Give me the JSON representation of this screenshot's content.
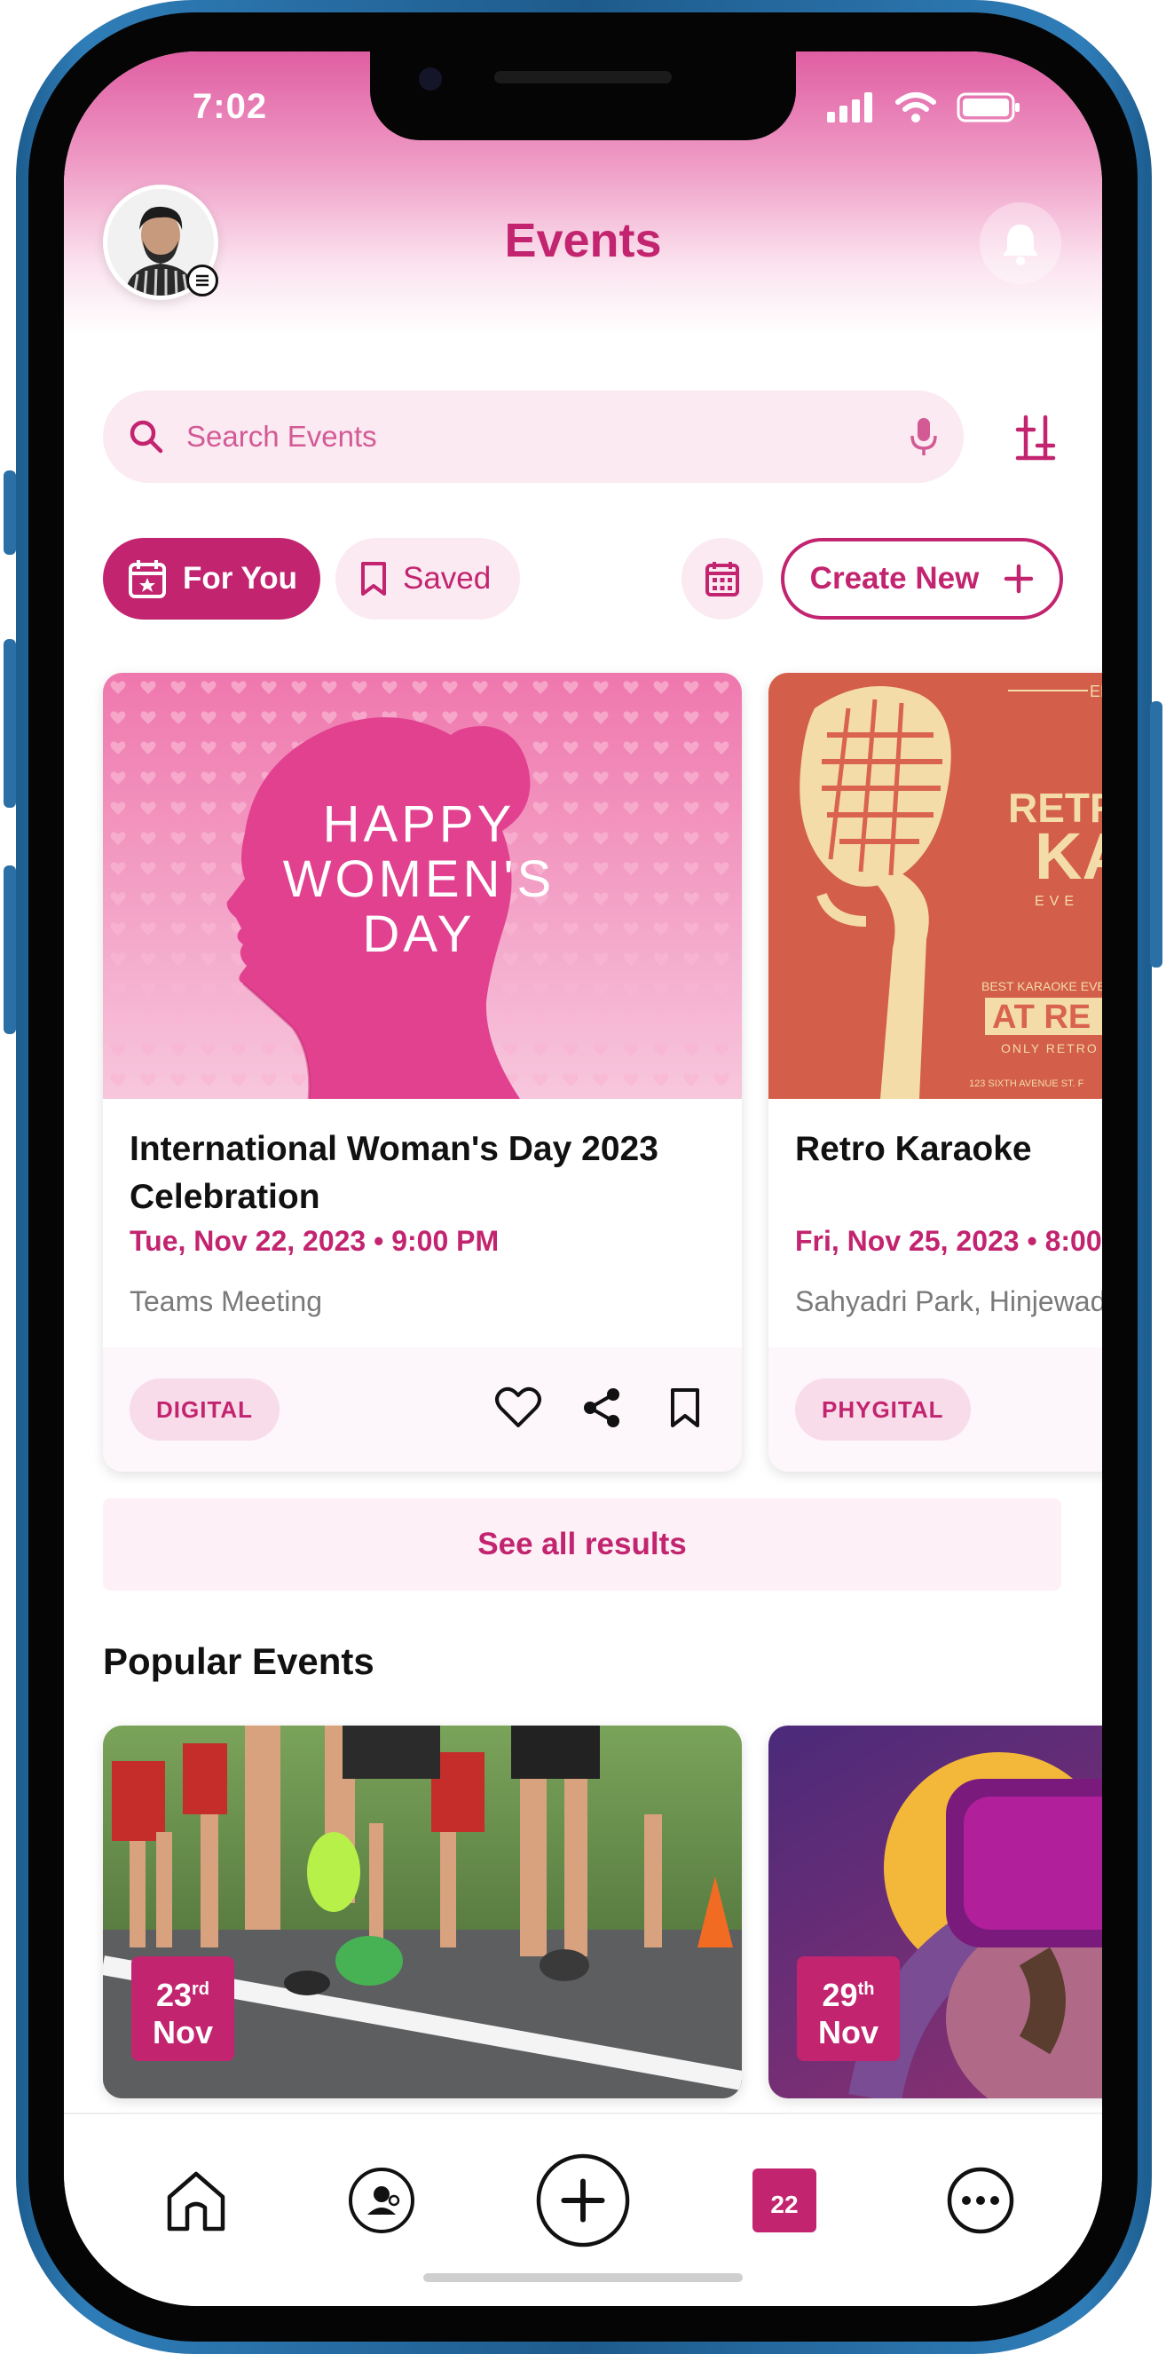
{
  "status_bar": {
    "time": "7:02"
  },
  "header": {
    "title": "Events"
  },
  "search": {
    "placeholder": "Search Events"
  },
  "filters": {
    "for_you_label": "For You",
    "saved_label": "Saved",
    "create_new_label": "Create New"
  },
  "events": [
    {
      "title": "International Woman's Day 2023 Celebration",
      "image_text": [
        "HAPPY",
        "WOMEN'S",
        "DAY"
      ],
      "date": "Tue, Nov 22, 2023 • 9:00 PM",
      "location": "Teams Meeting",
      "tag": "DIGITAL"
    },
    {
      "title": "Retro Karaoke",
      "image_text": [
        "EN",
        "RETR",
        "KA",
        "EVE",
        "BEST KARAOKE EVENT",
        "AT RE",
        "ONLY RETRO",
        "123 SIXTH AVENUE ST. F"
      ],
      "date": "Fri, Nov 25, 2023 • 8:00",
      "location": "Sahyadri Park, Hinjewadi",
      "tag": "PHYGITAL"
    }
  ],
  "see_all_label": "See all results",
  "popular": {
    "title": "Popular Events",
    "items": [
      {
        "day": "23",
        "suffix": "rd",
        "month": "Nov"
      },
      {
        "day": "29",
        "suffix": "th",
        "month": "Nov"
      }
    ]
  },
  "bottom_nav": {
    "calendar_day": "22"
  },
  "colors": {
    "accent": "#c2246f",
    "accent_light": "#fbeaf2",
    "header_gradient_top": "#e05ea3"
  }
}
